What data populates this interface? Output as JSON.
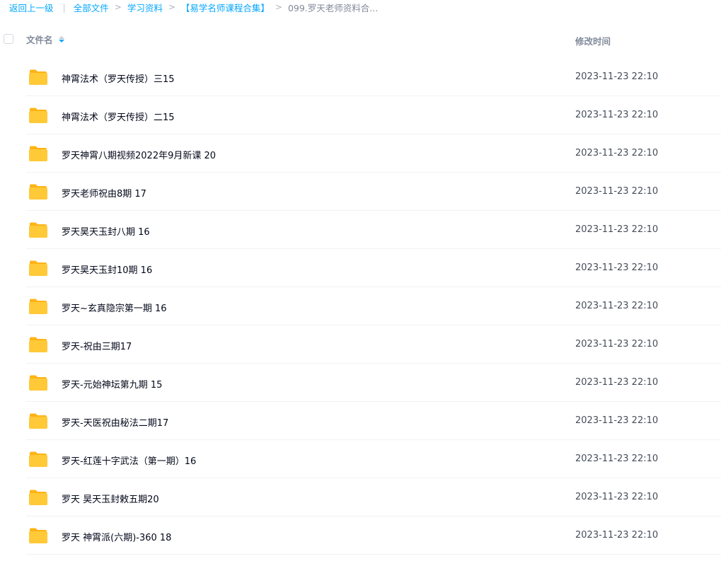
{
  "breadcrumb": {
    "back_label": "返回上一级",
    "divider": "|",
    "items": [
      "全部文件",
      "学习资料",
      "【易学名师课程合集】"
    ],
    "current": "099.罗天老师资料合...",
    "separator": ">"
  },
  "header": {
    "name_label": "文件名",
    "time_label": "修改时间"
  },
  "colors": {
    "link": "#06a7ff",
    "folder": "#ffc937",
    "folder_tab": "#ffb316"
  },
  "files": [
    {
      "name": "神霄法术（罗天传授）三15",
      "time": "2023-11-23 22:10",
      "icon": "folder-icon"
    },
    {
      "name": "神霄法术（罗天传授）二15",
      "time": "2023-11-23 22:10",
      "icon": "folder-icon"
    },
    {
      "name": "罗天神霄八期视频2022年9月新课 20",
      "time": "2023-11-23 22:10",
      "icon": "folder-icon"
    },
    {
      "name": "罗天老师祝由8期 17",
      "time": "2023-11-23 22:10",
      "icon": "folder-icon"
    },
    {
      "name": "罗天昊天玉封八期 16",
      "time": "2023-11-23 22:10",
      "icon": "folder-icon"
    },
    {
      "name": "罗天昊天玉封10期 16",
      "time": "2023-11-23 22:10",
      "icon": "folder-icon"
    },
    {
      "name": "罗天~玄真隐宗第一期 16",
      "time": "2023-11-23 22:10",
      "icon": "folder-icon"
    },
    {
      "name": "罗天-祝由三期17",
      "time": "2023-11-23 22:10",
      "icon": "folder-icon"
    },
    {
      "name": "罗天-元始神坛第九期 15",
      "time": "2023-11-23 22:10",
      "icon": "folder-icon"
    },
    {
      "name": "罗天-天医祝由秘法二期17",
      "time": "2023-11-23 22:10",
      "icon": "folder-icon"
    },
    {
      "name": "罗天-红莲十字武法（第一期）16",
      "time": "2023-11-23 22:10",
      "icon": "folder-icon"
    },
    {
      "name": "罗天 昊天玉封敕五期20",
      "time": "2023-11-23 22:10",
      "icon": "folder-icon"
    },
    {
      "name": "罗天 神霄派(六期)-360 18",
      "time": "2023-11-23 22:10",
      "icon": "folder-icon"
    }
  ]
}
